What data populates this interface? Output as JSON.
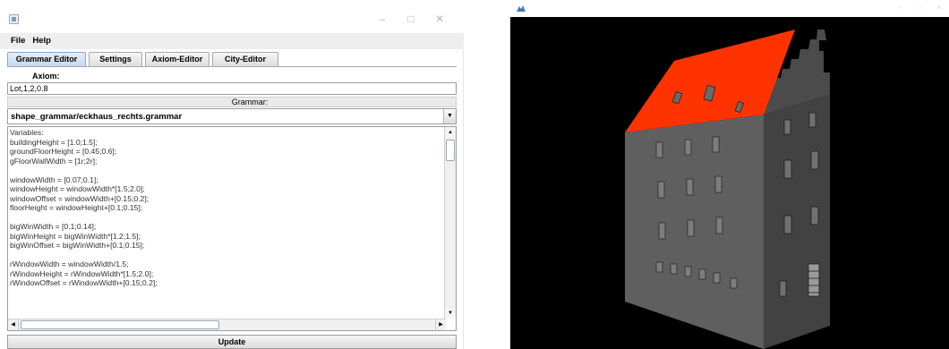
{
  "editor_window": {
    "menu": [
      "File",
      "Help"
    ],
    "tabs": [
      "Grammar Editor",
      "Settings",
      "Axiom-Editor",
      "City-Editor"
    ],
    "active_tab": "Grammar Editor",
    "axiom": {
      "label": "Axiom:",
      "value": "Lot,1,2,0.8"
    },
    "grammar": {
      "label": "Grammar:",
      "selected_file": "shape_grammar/eckhaus_rechts.grammar"
    },
    "code_lines": [
      "Variables:",
      "buildingHeight = [1.0;1.5];",
      "groundFloorHeight = [0.45;0.6];",
      "gFloorWallWidth = [1r;2r];",
      "",
      "windowWidth = [0.07;0.1];",
      "windowHeight = windowWidth*[1.5;2.0];",
      "windowOffset = windowWidth+[0.15;0.2];",
      "floorHeight = windowHeight+[0.1;0.15];",
      "",
      "bigWinWidth = [0.1;0.14];",
      "bigWinHeight = bigWinWidth*[1.2;1.5];",
      "bigWinOffset = bigWinWidth+[0.1;0.15];",
      "",
      "rWindowWidth = windowWidth/1.5;",
      "rWindowHeight = rWindowWidth*[1.5;2.0];",
      "rWindowOffset = rWindowWidth+[0.15;0.2];"
    ],
    "update_button": "Update"
  },
  "viewer_window": {
    "colors": {
      "roof": "#ff3300",
      "wall_front": "#5f5f5f",
      "wall_side": "#434343",
      "background": "#000000"
    }
  }
}
